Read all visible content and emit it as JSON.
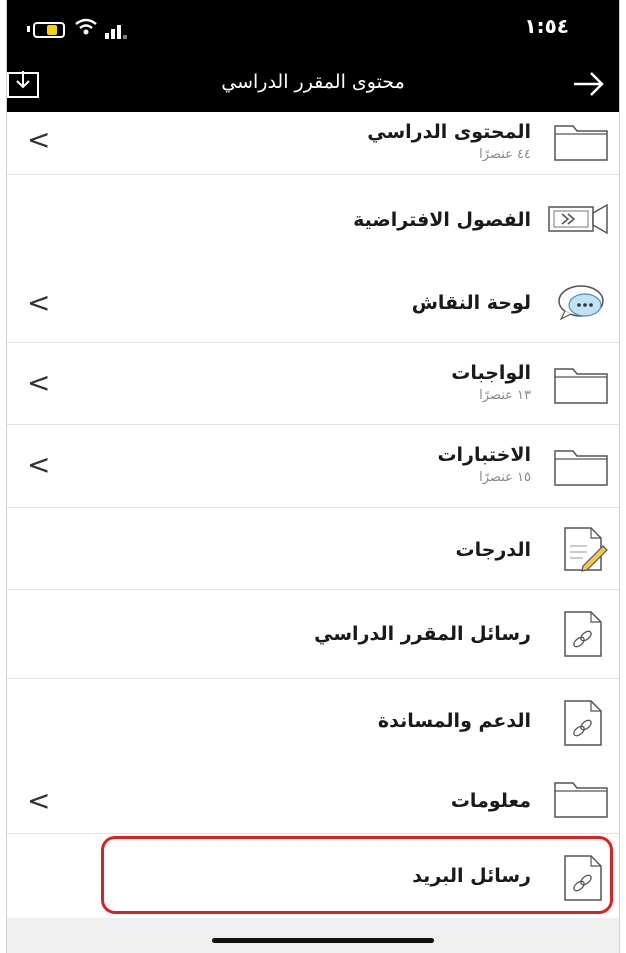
{
  "status": {
    "time": "١:٥٤"
  },
  "navbar": {
    "title": "محتوى المقرر الدراسي"
  },
  "items": [
    {
      "title": "المحتوى الدراسي",
      "subtitle": "٤٤ عنصرًا",
      "icon": "folder-icon",
      "chevron": true
    },
    {
      "title": "الفصول الافتراضية",
      "subtitle": "",
      "icon": "video-camera-icon",
      "chevron": false
    },
    {
      "title": "لوحة النقاش",
      "subtitle": "",
      "icon": "chat-bubble-icon",
      "chevron": true
    },
    {
      "title": "الواجبات",
      "subtitle": "١٣ عنصرًا",
      "icon": "folder-icon",
      "chevron": true
    },
    {
      "title": "الاختبارات",
      "subtitle": "١٥ عنصرًا",
      "icon": "folder-icon",
      "chevron": true
    },
    {
      "title": "الدرجات",
      "subtitle": "",
      "icon": "document-edit-icon",
      "chevron": false
    },
    {
      "title": "رسائل المقرر الدراسي",
      "subtitle": "",
      "icon": "document-link-icon",
      "chevron": false
    },
    {
      "title": "الدعم والمساندة",
      "subtitle": "",
      "icon": "document-link-icon",
      "chevron": false
    },
    {
      "title": "معلومات",
      "subtitle": "",
      "icon": "folder-icon",
      "chevron": true
    },
    {
      "title": "رسائل البريد",
      "subtitle": "",
      "icon": "document-link-icon",
      "chevron": false
    }
  ],
  "colors": {
    "bar": "#000000",
    "highlight": "#e02020",
    "battery": "#f4d100"
  }
}
